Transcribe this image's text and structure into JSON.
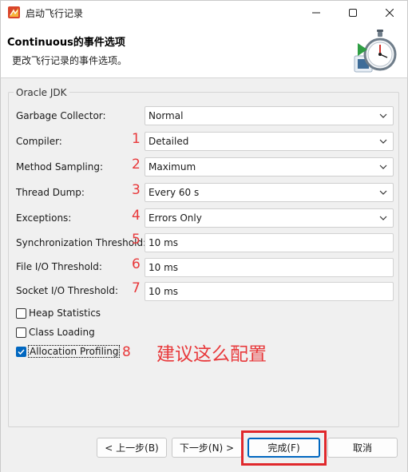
{
  "window": {
    "title": "启动飞行记录",
    "icon": "eclipse-jmc-icon"
  },
  "banner": {
    "title": "Continuous的事件选项",
    "description": "更改飞行记录的事件选项。",
    "image": "stopwatch-record-icon"
  },
  "group": {
    "title": "Oracle JDK"
  },
  "fields": {
    "garbage_collector": {
      "label": "Garbage Collector:",
      "value": "Normal",
      "marker": ""
    },
    "compiler": {
      "label": "Compiler:",
      "value": "Detailed",
      "marker": "1"
    },
    "method_sampling": {
      "label": "Method Sampling:",
      "value": "Maximum",
      "marker": "2"
    },
    "thread_dump": {
      "label": "Thread Dump:",
      "value": "Every 60 s",
      "marker": "3"
    },
    "exceptions": {
      "label": "Exceptions:",
      "value": "Errors Only",
      "marker": "4"
    },
    "sync_threshold": {
      "label": "Synchronization Threshold:",
      "value": "10 ms",
      "marker": "5"
    },
    "file_io_threshold": {
      "label": "File I/O Threshold:",
      "value": "10 ms",
      "marker": "6"
    },
    "socket_io_threshold": {
      "label": "Socket I/O Threshold:",
      "value": "10 ms",
      "marker": "7"
    }
  },
  "checkboxes": {
    "heap_statistics": {
      "label": "Heap Statistics",
      "checked": false
    },
    "class_loading": {
      "label": "Class Loading",
      "checked": false
    },
    "allocation_profiling": {
      "label": "Allocation Profiling",
      "checked": true,
      "marker": "8"
    }
  },
  "annotation": "建议这么配置",
  "buttons": {
    "back": "< 上一步(B)",
    "next": "下一步(N) >",
    "finish": "完成(F)",
    "cancel": "取消"
  },
  "colors": {
    "annotation_red": "#e8383a",
    "highlight_red": "#e0282c",
    "accent_blue": "#0067c0"
  }
}
